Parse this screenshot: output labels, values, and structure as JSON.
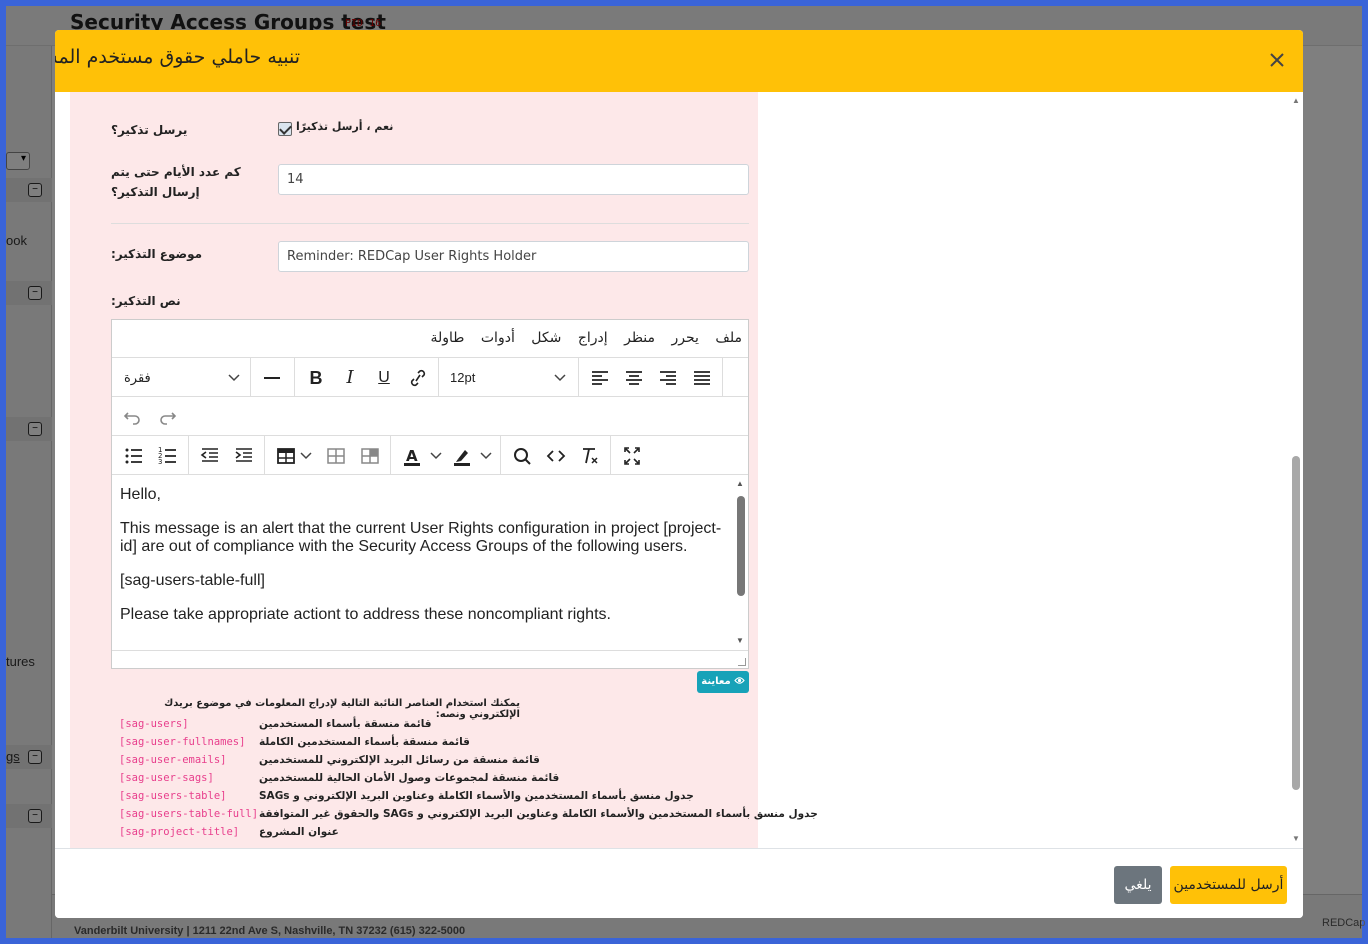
{
  "background": {
    "project_title": "Security Access Groups test",
    "pid": "PID 16",
    "left_texts": [
      "ook",
      "tures",
      "gs"
    ],
    "footer_text": "Vanderbilt University | 1211 22nd Ave S, Nashville, TN 37232 (615) 322-5000",
    "footer_right": "REDCap"
  },
  "modal": {
    "title": "تنبيه حاملي حقوق مستخدم المشروع",
    "close_icon": "close-icon",
    "reminder_label": "يرسل تذكير؟",
    "reminder_checkbox_label": "نعم ، أرسل تذكيرًا",
    "reminder_checked": true,
    "days_label": "كم عدد الأيام حتى يتم إرسال التذكير؟",
    "days_value": "14",
    "subject_label": "موضوع التذكير:",
    "subject_value": "Reminder: REDCap User Rights Holder",
    "body_label": "نص التذكير:",
    "editor": {
      "menu": [
        "ملف",
        "يحرر",
        "منظر",
        "إدراج",
        "شكل",
        "أدوات",
        "طاولة"
      ],
      "block_format": "فقرة",
      "font_size": "12pt",
      "content": [
        "Hello,",
        "This message is an alert that the current User Rights configuration in project [project-id] are out of compliance with the Security Access Groups of the following users.",
        "[sag-users-table-full]",
        "Please take appropriate actiont to address these noncompliant rights."
      ]
    },
    "preview_label": "معاينة",
    "placeholders_intro": "يمكنك استخدام العناصر النائبة التالية لإدراج المعلومات في موضوع بريدك الإلكتروني ونصه:",
    "placeholders": [
      {
        "key": "[sag-users]",
        "desc": "قائمة منسقة بأسماء المستخدمين"
      },
      {
        "key": "[sag-user-fullnames]",
        "desc": "قائمة منسقة بأسماء المستخدمين الكاملة"
      },
      {
        "key": "[sag-user-emails]",
        "desc": "قائمة منسقة من رسائل البريد الإلكتروني للمستخدمين"
      },
      {
        "key": "[sag-user-sags]",
        "desc": "قائمة منسقة لمجموعات وصول الأمان الحالية للمستخدمين"
      },
      {
        "key": "[sag-users-table]",
        "desc": "جدول منسق بأسماء المستخدمين والأسماء الكاملة وعناوين البريد الإلكتروني و SAGs"
      },
      {
        "key": "[sag-users-table-full]",
        "desc": "جدول منسق بأسماء المستخدمين والأسماء الكاملة وعناوين البريد الإلكتروني و SAGs والحقوق غير المتوافقة"
      },
      {
        "key": "[sag-project-title]",
        "desc": "عنوان المشروع"
      }
    ],
    "cancel_label": "يلغي",
    "send_label": "أرسل للمستخدمين"
  }
}
